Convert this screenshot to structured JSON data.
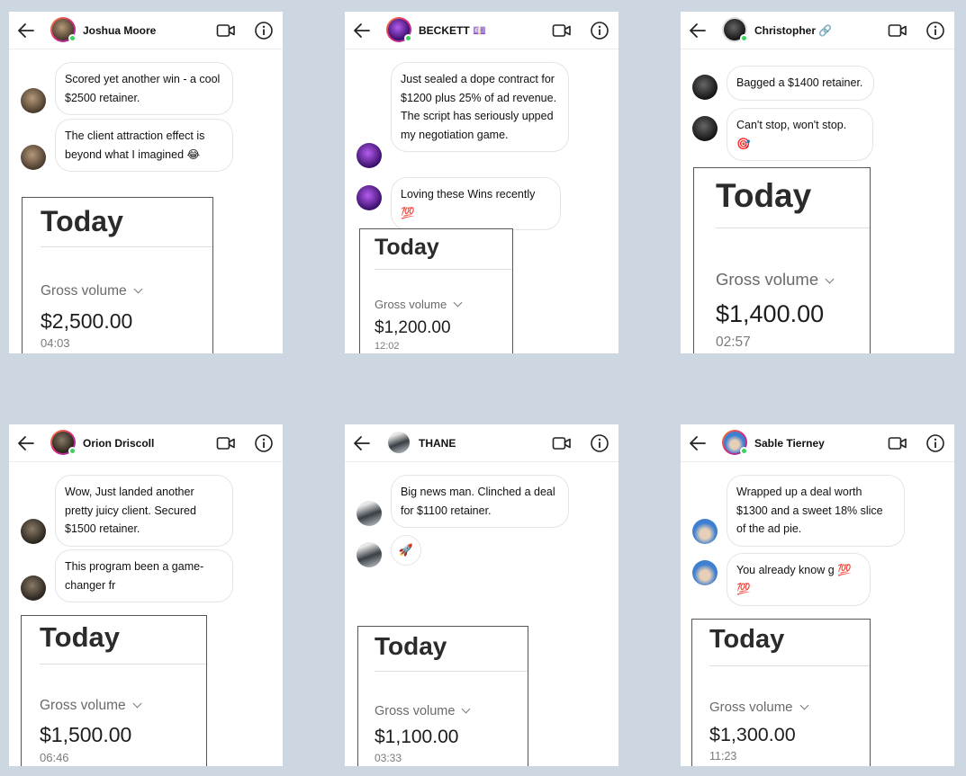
{
  "panels": [
    {
      "username": "Joshua Moore",
      "messages": [
        "Scored yet another win - a cool $2500 retainer.",
        "The client attraction effect is beyond what I imagined 😂"
      ],
      "card": {
        "title": "Today",
        "gross_label": "Gross volume",
        "amount": "$2,500.00",
        "time": "04:03"
      }
    },
    {
      "username": "BECKETT 💷",
      "messages": [
        "Just sealed a dope contract for $1200 plus 25% of ad revenue. The script has seriously upped my negotiation game.",
        "Loving these Wins recently 💯"
      ],
      "card": {
        "title": "Today",
        "gross_label": "Gross volume",
        "amount": "$1,200.00",
        "time": "12:02"
      }
    },
    {
      "username": "Christopher 🔗",
      "messages": [
        "Bagged a $1400 retainer.",
        "Can't stop, won't stop. 🎯"
      ],
      "card": {
        "title": "Today",
        "gross_label": "Gross volume",
        "amount": "$1,400.00",
        "time": "02:57"
      }
    },
    {
      "username": "Orion Driscoll",
      "messages": [
        "Wow, Just landed another pretty juicy client. Secured $1500 retainer.",
        "This program been a game-changer fr"
      ],
      "card": {
        "title": "Today",
        "gross_label": "Gross volume",
        "amount": "$1,500.00",
        "time": "06:46"
      }
    },
    {
      "username": "THANE",
      "messages": [
        "Big news man. Clinched a deal for $1100 retainer.",
        "🚀"
      ],
      "card": {
        "title": "Today",
        "gross_label": "Gross volume",
        "amount": "$1,100.00",
        "time": "03:33"
      }
    },
    {
      "username": "Sable Tierney",
      "messages": [
        "Wrapped up a deal worth $1300 and a sweet 18% slice of the ad pie.",
        "You already know g 💯 💯"
      ],
      "card": {
        "title": "Today",
        "gross_label": "Gross volume",
        "amount": "$1,300.00",
        "time": "11:23"
      }
    }
  ]
}
